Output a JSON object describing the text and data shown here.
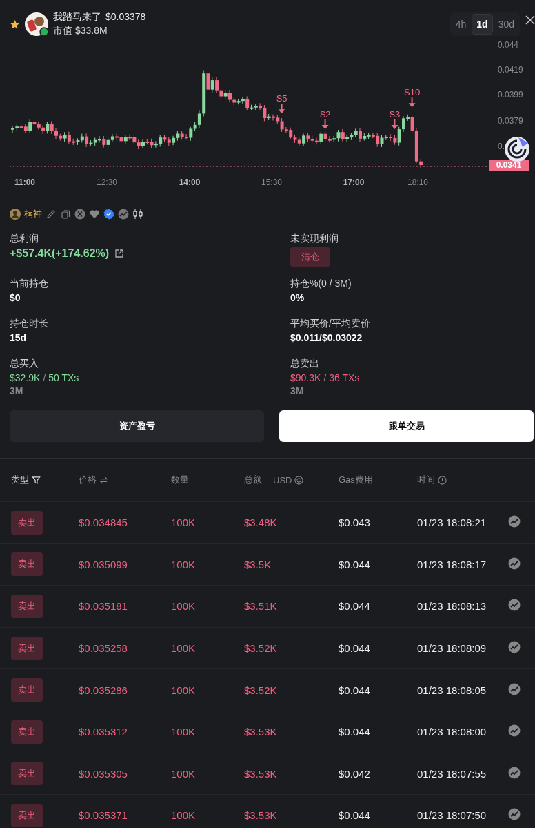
{
  "token": {
    "name": "我踏马来了",
    "price": "$0.03378",
    "market_cap": "市值 $33.8M",
    "favorited": true
  },
  "timeframes": [
    {
      "label": "4h",
      "selected": false
    },
    {
      "label": "1d",
      "selected": true
    },
    {
      "label": "30d",
      "selected": false
    }
  ],
  "chart": {
    "y_labels": [
      "0.044",
      "0.0419",
      "0.0399",
      "0.0379",
      "0."
    ],
    "x_labels": [
      {
        "label": "11:00",
        "major": true
      },
      {
        "label": "12:30",
        "major": false
      },
      {
        "label": "14:00",
        "major": true
      },
      {
        "label": "15:30",
        "major": false
      },
      {
        "label": "17:00",
        "major": true
      },
      {
        "label": "18:10",
        "major": false
      }
    ],
    "markers": [
      "S5",
      "S2",
      "S3",
      "S10"
    ],
    "current_price": "0.0341"
  },
  "trader": {
    "name": "楠神"
  },
  "stats": [
    {
      "label": "总利润",
      "value": "+$57.4K(+174.62%)",
      "kind": "profit"
    },
    {
      "label": "未实现利润",
      "badge": "清仓",
      "kind": "badge"
    },
    {
      "label": "当前持仓",
      "value": "$0",
      "kind": "plain"
    },
    {
      "label": "持仓%(0 / 3M)",
      "value": "0%",
      "kind": "plain"
    },
    {
      "label": "持仓时长",
      "value": "15d",
      "kind": "plain"
    },
    {
      "label": "平均买价/平均卖价",
      "value": "$0.011/$0.03022",
      "kind": "plain"
    },
    {
      "label": "总买入",
      "amount": "$32.9K",
      "separator": "/",
      "txs": "50 TXs",
      "sub": "3M",
      "kind": "buy"
    },
    {
      "label": "总卖出",
      "amount": "$90.3K",
      "separator": "/",
      "txs": "36 TXs",
      "sub": "3M",
      "kind": "sell"
    }
  ],
  "buttons": [
    {
      "label": "资产盈亏",
      "kind": "secondary"
    },
    {
      "label": "跟单交易",
      "kind": "primary"
    }
  ],
  "table": {
    "columns": [
      "类型",
      "价格",
      "数量",
      "总额",
      "Gas费用",
      "时间"
    ],
    "currency": "USD",
    "rows": [
      {
        "type": "卖出",
        "kind": "sell",
        "price": "$0.034845",
        "amount": "100K",
        "total": "$3.48K",
        "gas": "$0.043",
        "time": "01/23 18:08:21"
      },
      {
        "type": "卖出",
        "kind": "sell",
        "price": "$0.035099",
        "amount": "100K",
        "total": "$3.5K",
        "gas": "$0.044",
        "time": "01/23 18:08:17"
      },
      {
        "type": "卖出",
        "kind": "sell",
        "price": "$0.035181",
        "amount": "100K",
        "total": "$3.51K",
        "gas": "$0.044",
        "time": "01/23 18:08:13"
      },
      {
        "type": "卖出",
        "kind": "sell",
        "price": "$0.035258",
        "amount": "100K",
        "total": "$3.52K",
        "gas": "$0.044",
        "time": "01/23 18:08:09"
      },
      {
        "type": "卖出",
        "kind": "sell",
        "price": "$0.035286",
        "amount": "100K",
        "total": "$3.52K",
        "gas": "$0.044",
        "time": "01/23 18:08:05"
      },
      {
        "type": "卖出",
        "kind": "sell",
        "price": "$0.035312",
        "amount": "100K",
        "total": "$3.53K",
        "gas": "$0.044",
        "time": "01/23 18:08:00"
      },
      {
        "type": "卖出",
        "kind": "sell",
        "price": "$0.035305",
        "amount": "100K",
        "total": "$3.53K",
        "gas": "$0.042",
        "time": "01/23 18:07:55"
      },
      {
        "type": "卖出",
        "kind": "sell",
        "price": "$0.035371",
        "amount": "100K",
        "total": "$3.53K",
        "gas": "$0.044",
        "time": "01/23 18:07:50"
      }
    ]
  }
}
